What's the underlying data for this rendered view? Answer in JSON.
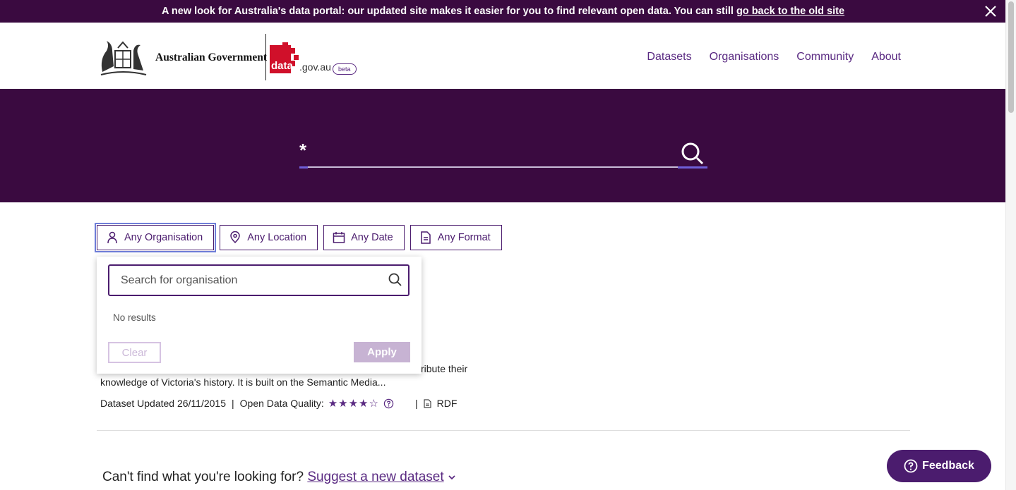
{
  "banner": {
    "text": "A new look for Australia's data portal: our updated site makes it easier for you to find relevant open data. You can still",
    "link": "go back to the old site",
    "close_icon": "close-icon"
  },
  "header": {
    "gov_name": "Australian Government",
    "data_word": "data",
    "govau_word": ".gov.au",
    "beta": "beta",
    "nav": [
      "Datasets",
      "Organisations",
      "Community",
      "About"
    ]
  },
  "search": {
    "query": "*",
    "icon": "search-icon"
  },
  "filters": {
    "organisation": "Any Organisation",
    "location": "Any Location",
    "date": "Any Date",
    "format": "Any Format"
  },
  "dropdown": {
    "placeholder": "Search for organisation",
    "no_results": "No results",
    "clear": "Clear",
    "apply": "Apply"
  },
  "result": {
    "desc_line1": "ribute their",
    "desc_line2": "knowledge of Victoria's history. It is built on the Semantic Media...",
    "updated": "Dataset Updated 26/11/2015",
    "sep": "|",
    "quality_label": "Open Data Quality:",
    "stars": "★★★★☆",
    "quality_rating": 4,
    "format": "RDF"
  },
  "footer": {
    "question": "Can't find what you're looking for?",
    "suggest_link": "Suggest a new dataset",
    "feedback": "Feedback"
  },
  "colors": {
    "brand_purple": "#3a0a40",
    "accent": "#5a2a82"
  }
}
